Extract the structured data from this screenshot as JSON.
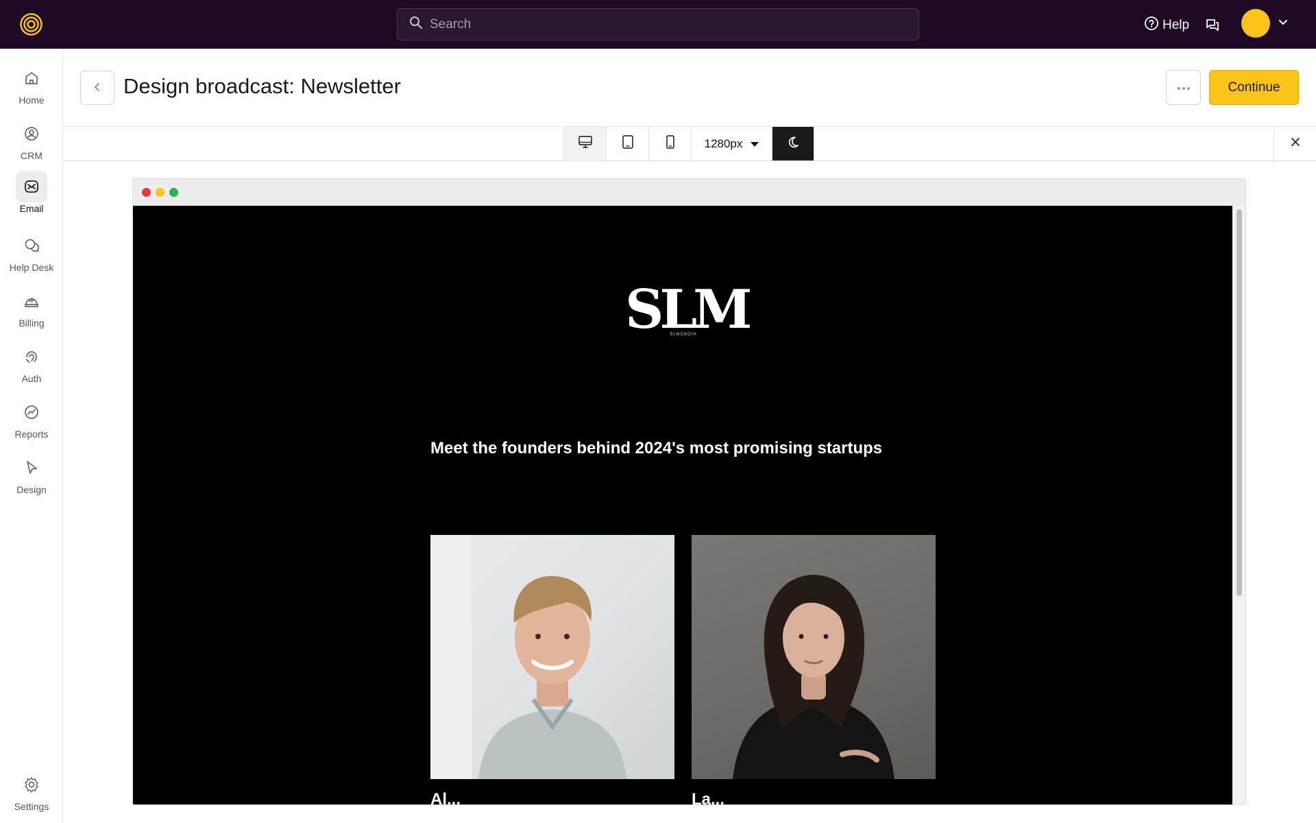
{
  "topbar": {
    "search_placeholder": "Search",
    "help_label": "Help"
  },
  "sidebar": {
    "items": [
      {
        "label": "Home",
        "icon": "home-icon"
      },
      {
        "label": "CRM",
        "icon": "user-circle-icon"
      },
      {
        "label": "Email",
        "icon": "email-icon",
        "active": true
      },
      {
        "label": "Help Desk",
        "icon": "chat-bubbles-icon"
      },
      {
        "label": "Billing",
        "icon": "billing-icon"
      },
      {
        "label": "Auth",
        "icon": "fingerprint-icon"
      },
      {
        "label": "Reports",
        "icon": "chart-icon"
      },
      {
        "label": "Design",
        "icon": "cursor-icon"
      }
    ],
    "settings_label": "Settings"
  },
  "header": {
    "title": "Design broadcast: Newsletter",
    "continue_label": "Continue"
  },
  "toolbar": {
    "width_value": "1280px",
    "active_device": "desktop",
    "dark_mode": true
  },
  "email": {
    "brand": "SLM",
    "brand_sub": "SLMCBOIH",
    "headline": "Meet the founders behind 2024's most promising startups",
    "founders": [
      {
        "name": "Al..."
      },
      {
        "name": "La..."
      }
    ]
  },
  "colors": {
    "topbar_bg": "#1f0a26",
    "accent": "#fcc419",
    "email_bg": "#000000"
  }
}
